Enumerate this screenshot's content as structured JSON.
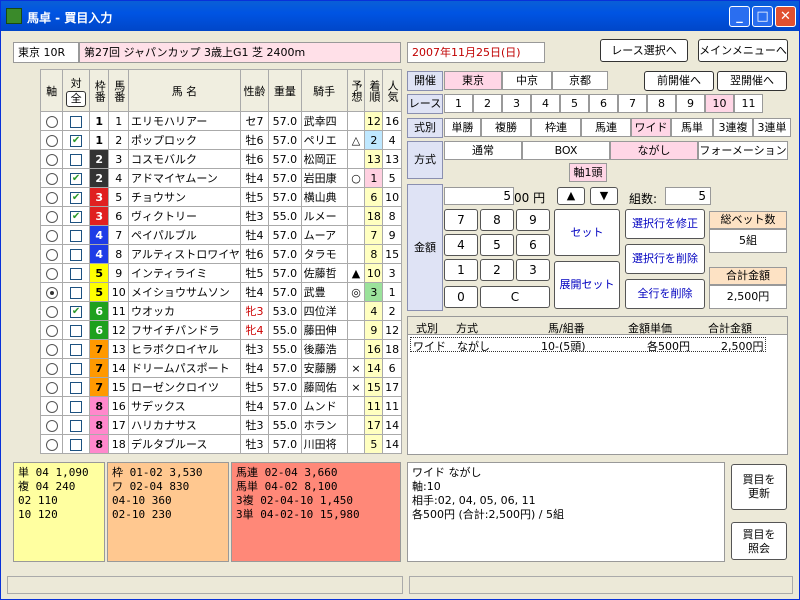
{
  "window": {
    "title": "馬卓 - 買目入力"
  },
  "header": {
    "race": "東京 10R",
    "race_name": "第27回 ジャパンカップ 3歳上G1 芝 2400m",
    "date": "2007年11月25日(日)",
    "race_select_button": "レース選択へ",
    "main_menu_button": "メインメニューへ"
  },
  "table": {
    "col_axis": "軸",
    "col_target": "対",
    "all_button": "全",
    "col_waku": "枠番",
    "col_umaban": "馬番",
    "col_name": "馬 名",
    "col_sexage": "性齢",
    "col_weight": "重量",
    "col_jockey": "騎手",
    "col_pred": "予想",
    "col_finish": "着順",
    "col_pop": "人気",
    "rows": [
      {
        "axis": false,
        "target": false,
        "waku": "1",
        "umaban": "1",
        "name": "エリモハリアー",
        "sexage": "セ7",
        "weight": "57.0",
        "jockey": "武幸四",
        "pred": "",
        "finish": "12",
        "pop": "16"
      },
      {
        "axis": false,
        "target": true,
        "waku": "1",
        "umaban": "2",
        "name": "ポップロック",
        "sexage": "牡6",
        "weight": "57.0",
        "jockey": "ペリエ",
        "pred": "△",
        "finish": "2",
        "pop": "4"
      },
      {
        "axis": false,
        "target": false,
        "waku": "2",
        "umaban": "3",
        "name": "コスモバルク",
        "sexage": "牡6",
        "weight": "57.0",
        "jockey": "松岡正",
        "pred": "",
        "finish": "13",
        "pop": "13"
      },
      {
        "axis": false,
        "target": true,
        "waku": "2",
        "umaban": "4",
        "name": "アドマイヤムーン",
        "sexage": "牡4",
        "weight": "57.0",
        "jockey": "岩田康",
        "pred": "○",
        "finish": "1",
        "pop": "5"
      },
      {
        "axis": false,
        "target": true,
        "waku": "3",
        "umaban": "5",
        "name": "チョウサン",
        "sexage": "牡5",
        "weight": "57.0",
        "jockey": "横山典",
        "pred": "",
        "finish": "6",
        "pop": "10"
      },
      {
        "axis": false,
        "target": true,
        "waku": "3",
        "umaban": "6",
        "name": "ヴィクトリー",
        "sexage": "牡3",
        "weight": "55.0",
        "jockey": "ルメー",
        "pred": "",
        "finish": "18",
        "pop": "8"
      },
      {
        "axis": false,
        "target": false,
        "waku": "4",
        "umaban": "7",
        "name": "ペイパルブル",
        "sexage": "牡4",
        "weight": "57.0",
        "jockey": "ムーア",
        "pred": "",
        "finish": "7",
        "pop": "9"
      },
      {
        "axis": false,
        "target": false,
        "waku": "4",
        "umaban": "8",
        "name": "アルティストロワイヤ",
        "sexage": "牡6",
        "weight": "57.0",
        "jockey": "タラモ",
        "pred": "",
        "finish": "8",
        "pop": "15"
      },
      {
        "axis": false,
        "target": false,
        "waku": "5",
        "umaban": "9",
        "name": "インティライミ",
        "sexage": "牡5",
        "weight": "57.0",
        "jockey": "佐藤哲",
        "pred": "▲",
        "finish": "10",
        "pop": "3"
      },
      {
        "axis": true,
        "target": false,
        "waku": "5",
        "umaban": "10",
        "name": "メイショウサムソン",
        "sexage": "牡4",
        "weight": "57.0",
        "jockey": "武豊",
        "pred": "◎",
        "finish": "3",
        "pop": "1"
      },
      {
        "axis": false,
        "target": true,
        "waku": "6",
        "umaban": "11",
        "name": "ウオッカ",
        "sexage": "牝3",
        "weight": "53.0",
        "jockey": "四位洋",
        "pred": "",
        "finish": "4",
        "pop": "2"
      },
      {
        "axis": false,
        "target": false,
        "waku": "6",
        "umaban": "12",
        "name": "フサイチパンドラ",
        "sexage": "牝4",
        "weight": "55.0",
        "jockey": "藤田伸",
        "pred": "",
        "finish": "9",
        "pop": "12"
      },
      {
        "axis": false,
        "target": false,
        "waku": "7",
        "umaban": "13",
        "name": "ヒラボクロイヤル",
        "sexage": "牡3",
        "weight": "55.0",
        "jockey": "後藤浩",
        "pred": "",
        "finish": "16",
        "pop": "18"
      },
      {
        "axis": false,
        "target": false,
        "waku": "7",
        "umaban": "14",
        "name": "ドリームパスポート",
        "sexage": "牡4",
        "weight": "57.0",
        "jockey": "安藤勝",
        "pred": "×",
        "finish": "14",
        "pop": "6"
      },
      {
        "axis": false,
        "target": false,
        "waku": "7",
        "umaban": "15",
        "name": "ローゼンクロイツ",
        "sexage": "牡5",
        "weight": "57.0",
        "jockey": "藤岡佑",
        "pred": "×",
        "finish": "15",
        "pop": "17"
      },
      {
        "axis": false,
        "target": false,
        "waku": "8",
        "umaban": "16",
        "name": "サデックス",
        "sexage": "牡4",
        "weight": "57.0",
        "jockey": "ムンド",
        "pred": "",
        "finish": "11",
        "pop": "11"
      },
      {
        "axis": false,
        "target": false,
        "waku": "8",
        "umaban": "17",
        "name": "ハリカナサス",
        "sexage": "牡3",
        "weight": "55.0",
        "jockey": "ホラン",
        "pred": "",
        "finish": "17",
        "pop": "14"
      },
      {
        "axis": false,
        "target": false,
        "waku": "8",
        "umaban": "18",
        "name": "デルタブルース",
        "sexage": "牡3",
        "weight": "57.0",
        "jockey": "川田将",
        "pred": "",
        "finish": "5",
        "pop": "14"
      }
    ]
  },
  "venue": {
    "label": "開催",
    "items": [
      "東京",
      "中京",
      "京都"
    ],
    "prev": "前開催へ",
    "next": "翌開催へ"
  },
  "race": {
    "label": "レース",
    "items": [
      "1",
      "2",
      "3",
      "4",
      "5",
      "6",
      "7",
      "8",
      "9",
      "10",
      "11"
    ]
  },
  "bettype": {
    "label": "式別",
    "items": [
      "単勝",
      "複勝",
      "枠連",
      "馬連",
      "ワイド",
      "馬単",
      "3連複",
      "3連単"
    ]
  },
  "method": {
    "label": "方式",
    "items": [
      "通常",
      "BOX",
      "ながし",
      "フォーメーション"
    ],
    "axis1": "軸1頭"
  },
  "amount": {
    "label": "金額",
    "value": "5",
    "unit": "00 円",
    "up": "▲",
    "down": "▼",
    "count_label": "組数:",
    "count": "5",
    "keys": [
      "7",
      "8",
      "9",
      "4",
      "5",
      "6",
      "1",
      "2",
      "3",
      "0",
      "C"
    ],
    "set": "セット",
    "expand_set": "展開セット",
    "modify": "選択行を修正",
    "delete": "選択行を削除",
    "delete_all": "全行を削除",
    "total_bets_label": "総ベット数",
    "total_bets": "5組",
    "total_amount_label": "合計金額",
    "total_amount": "2,500円"
  },
  "list": {
    "headers": [
      "式別",
      "方式",
      "馬/組番",
      "金額単価",
      "合計金額"
    ],
    "row": {
      "type": "ワイド",
      "method": "ながし",
      "combo": "10-(5頭)",
      "unit": "各500円",
      "total": "2,500円"
    }
  },
  "payouts": {
    "tanfuku": [
      "単 04   1,090",
      "複 04     240",
      "   02     110",
      "   10     120"
    ],
    "waku": [
      "枠 01-02   3,530",
      "ワ 02-04     830",
      "   04-10     360",
      "   02-10     230"
    ],
    "umaren": [
      "馬連 02-04        3,660",
      "馬単 04-02        8,100",
      "3複 02-04-10     1,450",
      "3単 04-02-10    15,980"
    ]
  },
  "summary": {
    "lines": [
      "ワイド ながし",
      "軸:10",
      "相手:02, 04, 05, 06, 11",
      "各500円 (合計:2,500円) / 5組"
    ],
    "update_btn": [
      "買目を",
      "更新"
    ],
    "inquiry_btn": [
      "買目を",
      "照会"
    ]
  },
  "colors": {
    "title_bar": "#0054e3",
    "waku1": "#ffffff",
    "waku2": "#333333",
    "waku3": "#e02020",
    "waku4": "#1e3ce6",
    "waku5": "#ffff00",
    "waku6": "#1ea01e",
    "waku7": "#ff9900",
    "waku8": "#ff88cc"
  }
}
